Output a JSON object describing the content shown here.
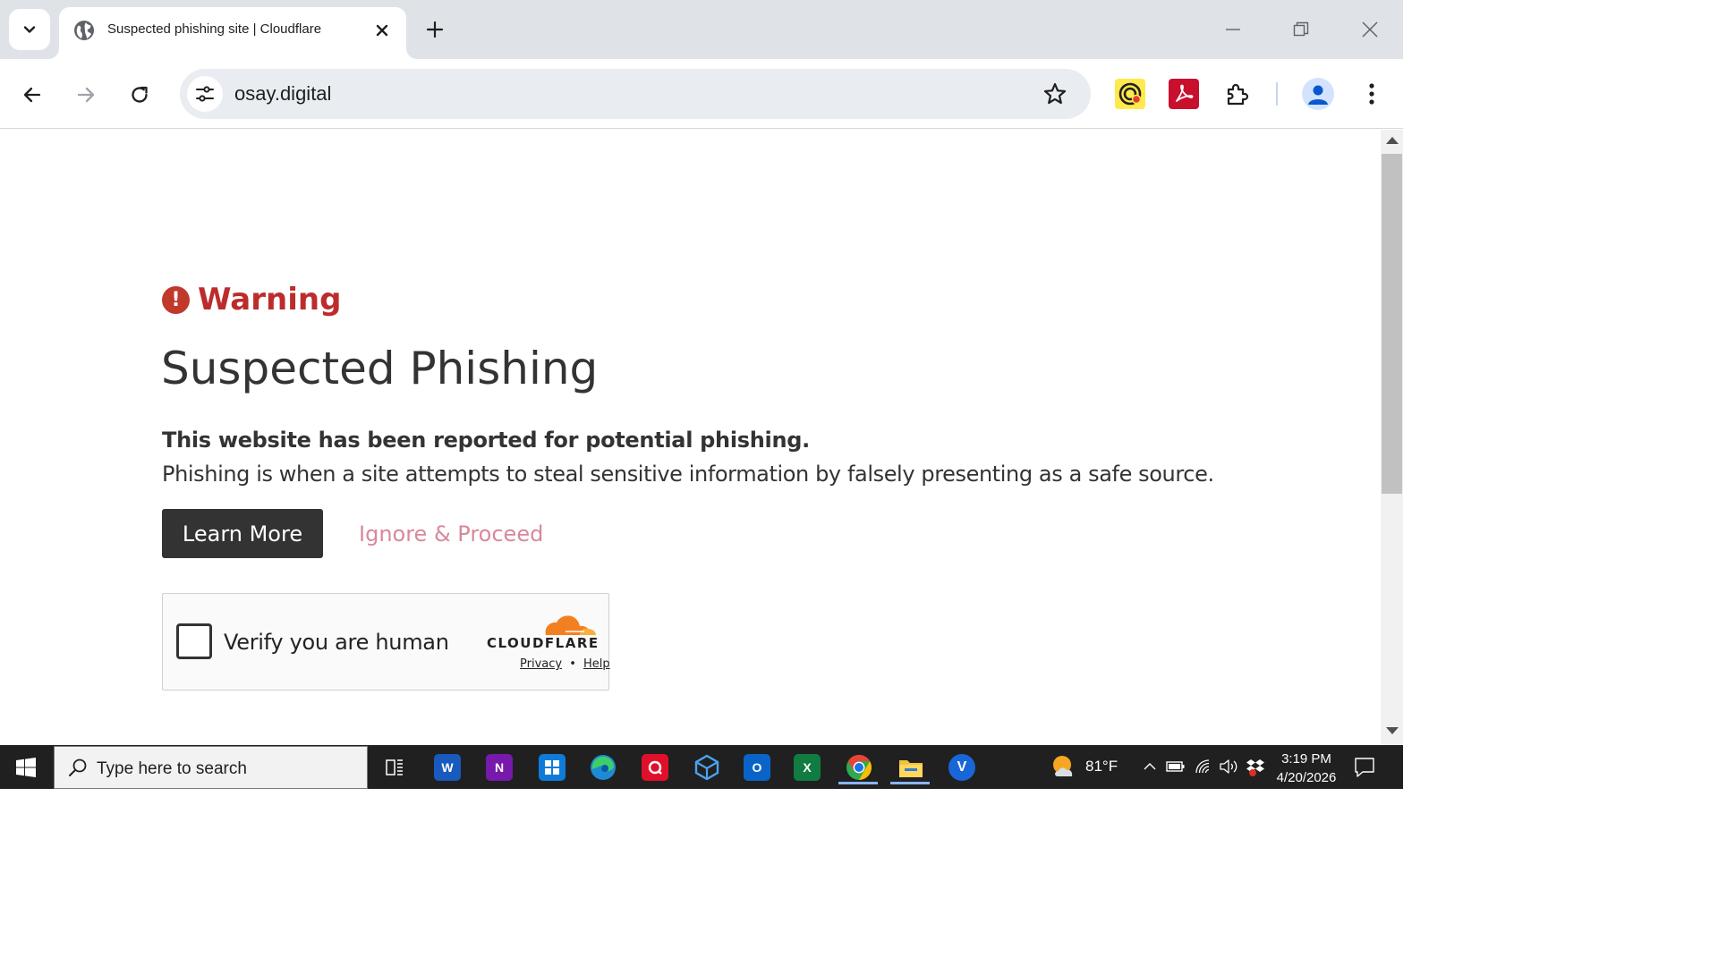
{
  "browser": {
    "tab": {
      "title": "Suspected phishing site | Cloudflare"
    },
    "url": "osay.digital"
  },
  "page": {
    "warning_label": "Warning",
    "headline": "Suspected Phishing",
    "description_bold": "This website has been reported for potential phishing.",
    "description": "Phishing is when a site attempts to steal sensitive information by falsely presenting as a safe source.",
    "learn_more_label": "Learn More",
    "ignore_label": "Ignore & Proceed",
    "turnstile": {
      "label": "Verify you are human",
      "brand": "CLOUDFLARE",
      "privacy_label": "Privacy",
      "separator": "•",
      "help_label": "Help"
    }
  },
  "taskbar": {
    "search_placeholder": "Type here to search",
    "weather_temp": "81°F",
    "time": "3:19 PM",
    "date": "4/20/2026",
    "apps": [
      "task-view",
      "word",
      "onenote",
      "store",
      "edge",
      "acrobat",
      "azure-vpn",
      "outlook",
      "excel",
      "chrome",
      "file-explorer",
      "viva"
    ]
  },
  "colors": {
    "warning_red": "#bd2c2c",
    "button_dark": "#333333",
    "ignore_pink": "#d8889a",
    "cloudflare_orange": "#f38020"
  }
}
